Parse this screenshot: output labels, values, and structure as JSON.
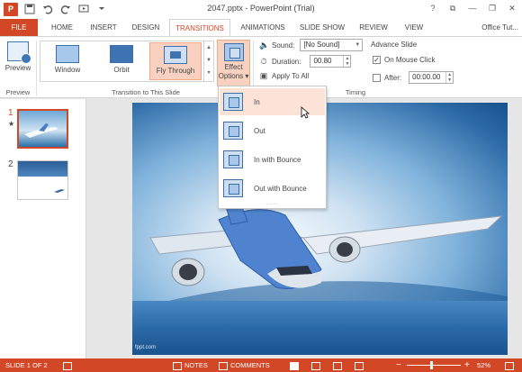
{
  "window": {
    "title": "2047.pptx - PowerPoint (Trial)",
    "app_icon": "P",
    "controls": [
      "?",
      "⧉",
      "—",
      "❐",
      "✕"
    ]
  },
  "qat": {
    "save_icon": "save-icon",
    "undo_icon": "undo-icon",
    "redo_icon": "redo-icon",
    "customize_icon": "customize-icon"
  },
  "tabs": {
    "items": [
      {
        "label": "FILE"
      },
      {
        "label": "HOME"
      },
      {
        "label": "INSERT"
      },
      {
        "label": "DESIGN"
      },
      {
        "label": "TRANSITIONS"
      },
      {
        "label": "ANIMATIONS"
      },
      {
        "label": "SLIDE SHOW"
      },
      {
        "label": "REVIEW"
      },
      {
        "label": "VIEW"
      }
    ],
    "active": "TRANSITIONS",
    "user": "Office Tut..."
  },
  "ribbon": {
    "preview": {
      "label": "Preview",
      "group": "Preview"
    },
    "gallery": {
      "items": [
        {
          "label": "Window"
        },
        {
          "label": "Orbit"
        },
        {
          "label": "Fly Through"
        }
      ],
      "selected": "Fly Through",
      "group": "Transition to This Slide"
    },
    "effect_options": {
      "label_line1": "Effect",
      "label_line2": "Options ▾"
    },
    "timing": {
      "sound_label": "Sound:",
      "sound_value": "[No Sound]",
      "duration_label": "Duration:",
      "duration_value": "00.80",
      "apply_label": "Apply To All",
      "advance_label": "Advance Slide",
      "on_click_label": "On Mouse Click",
      "on_click_checked": true,
      "after_label": "After:",
      "after_checked": false,
      "after_value": "00:00.00",
      "group": "Timing"
    }
  },
  "effect_menu": {
    "items": [
      {
        "label": "In"
      },
      {
        "label": "Out"
      },
      {
        "label": "In with Bounce"
      },
      {
        "label": "Out with Bounce"
      }
    ],
    "highlighted": "In",
    "grip": "....."
  },
  "slides": {
    "thumbnails": [
      {
        "number": "1",
        "marker": "★",
        "selected": true
      },
      {
        "number": "2",
        "marker": "",
        "selected": false
      }
    ],
    "current_watermark": "fppt.com"
  },
  "status": {
    "slide_info": "SLIDE 1 OF 2",
    "notes": "NOTES",
    "comments": "COMMENTS",
    "zoom_minus": "−",
    "zoom_plus": "+",
    "zoom_level": "52%"
  },
  "colors": {
    "accent": "#d24726",
    "selection": "#f8d1c0",
    "menu_highlight": "#fce3d8"
  }
}
